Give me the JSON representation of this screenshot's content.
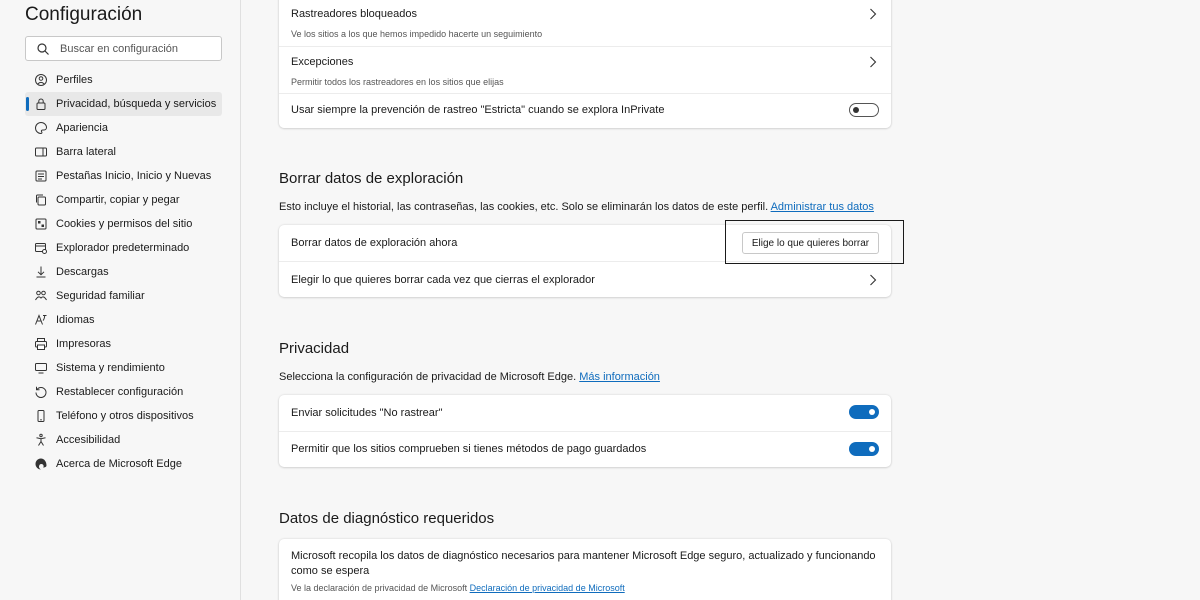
{
  "sidebar": {
    "title": "Configuración",
    "search_placeholder": "Buscar en configuración",
    "items": [
      {
        "label": "Perfiles",
        "icon": "profile-icon"
      },
      {
        "label": "Privacidad, búsqueda y servicios",
        "icon": "lock-icon",
        "active": true
      },
      {
        "label": "Apariencia",
        "icon": "appearance-icon"
      },
      {
        "label": "Barra lateral",
        "icon": "sidebar-icon"
      },
      {
        "label": "Pestañas Inicio, Inicio y Nuevas",
        "icon": "home-tabs-icon"
      },
      {
        "label": "Compartir, copiar y pegar",
        "icon": "share-icon"
      },
      {
        "label": "Cookies y permisos del sitio",
        "icon": "cookies-icon"
      },
      {
        "label": "Explorador predeterminado",
        "icon": "browser-icon"
      },
      {
        "label": "Descargas",
        "icon": "download-icon"
      },
      {
        "label": "Seguridad familiar",
        "icon": "family-icon"
      },
      {
        "label": "Idiomas",
        "icon": "language-icon"
      },
      {
        "label": "Impresoras",
        "icon": "printer-icon"
      },
      {
        "label": "Sistema y rendimiento",
        "icon": "system-icon"
      },
      {
        "label": "Restablecer configuración",
        "icon": "reset-icon"
      },
      {
        "label": "Teléfono y otros dispositivos",
        "icon": "phone-icon"
      },
      {
        "label": "Accesibilidad",
        "icon": "accessibility-icon"
      },
      {
        "label": "Acerca de Microsoft Edge",
        "icon": "edge-icon"
      }
    ]
  },
  "tracking": {
    "blocked_title": "Rastreadores bloqueados",
    "blocked_sub": "Ve los sitios a los que hemos impedido hacerte un seguimiento",
    "exceptions_title": "Excepciones",
    "exceptions_sub": "Permitir todos los rastreadores en los sitios que elijas",
    "strict_label": "Usar siempre la prevención de rastreo \"Estricta\" cuando se explora InPrivate",
    "strict_on": false
  },
  "clear": {
    "title": "Borrar datos de exploración",
    "desc": "Esto incluye el historial, las contraseñas, las cookies, etc. Solo se eliminarán los datos de este perfil.",
    "desc_link": "Administrar tus datos",
    "now_label": "Borrar datos de exploración ahora",
    "now_button": "Elige lo que quieres borrar",
    "on_close_label": "Elegir lo que quieres borrar cada vez que cierras el explorador"
  },
  "privacy": {
    "title": "Privacidad",
    "desc": "Selecciona la configuración de privacidad de Microsoft Edge.",
    "desc_link": "Más información",
    "dnt_label": "Enviar solicitudes \"No rastrear\"",
    "dnt_on": true,
    "payment_label": "Permitir que los sitios comprueben si tienes métodos de pago guardados",
    "payment_on": true
  },
  "diagnostics": {
    "title": "Datos de diagnóstico requeridos",
    "text_line1": "Microsoft recopila los datos de diagnóstico necesarios para mantener Microsoft Edge seguro, actualizado y funcionando",
    "text_line2": "como se espera",
    "sub": "Ve la declaración de privacidad de Microsoft",
    "sub_link": "Declaración de privacidad de Microsoft"
  },
  "colors": {
    "accent": "#0f6cbd",
    "background": "#f7f7f7",
    "card": "#ffffff"
  }
}
